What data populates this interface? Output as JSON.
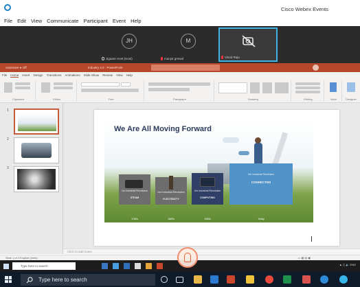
{
  "app": {
    "title": "Cisco Webex Events"
  },
  "menu": [
    "File",
    "Edit",
    "View",
    "Communicate",
    "Participant",
    "Event",
    "Help"
  ],
  "participants": [
    {
      "initials": "JH",
      "name": "Jigaare Host (Host)",
      "muted": false
    },
    {
      "initials": "M",
      "name": "manjot grewal",
      "muted": true
    },
    {
      "initials": "",
      "name": "Vinod Raju",
      "muted": true,
      "video_off": true
    }
  ],
  "powerpoint": {
    "tabs": [
      "File",
      "Home",
      "Insert",
      "Design",
      "Transitions",
      "Animations",
      "Slide Show",
      "Review",
      "View",
      "Help"
    ],
    "ribbon_groups": [
      "Clipboard",
      "Slides",
      "Font",
      "Paragraph",
      "Drawing",
      "Editing",
      "Voice",
      "Designer"
    ],
    "slide_numbers": [
      "1",
      "2",
      "3"
    ],
    "notes_placeholder": "Click to add notes",
    "status_left": "Slide 1 of 3   English (India)"
  },
  "slide": {
    "title": "We Are All Moving Forward",
    "eras": [
      {
        "label": "1st Industrial Revolution",
        "tech": "STEAM",
        "year": "1760s"
      },
      {
        "label": "2nd Industrial Revolution",
        "tech": "ELECTRICITY",
        "year": "1860s"
      },
      {
        "label": "3rd Industrial Revolution",
        "tech": "COMPUTING",
        "year": "1960s"
      },
      {
        "label": "4th Industrial Revolution",
        "tech": "CONNECTED",
        "year": "Today"
      }
    ]
  },
  "taskbar": {
    "inner_search_placeholder": "Type here to search",
    "search_placeholder": "Type here to search"
  },
  "colors": {
    "ppt_accent": "#b7472a",
    "webex_blue": "#41b6e6",
    "taskbar_bg": "#0f1b2a"
  }
}
